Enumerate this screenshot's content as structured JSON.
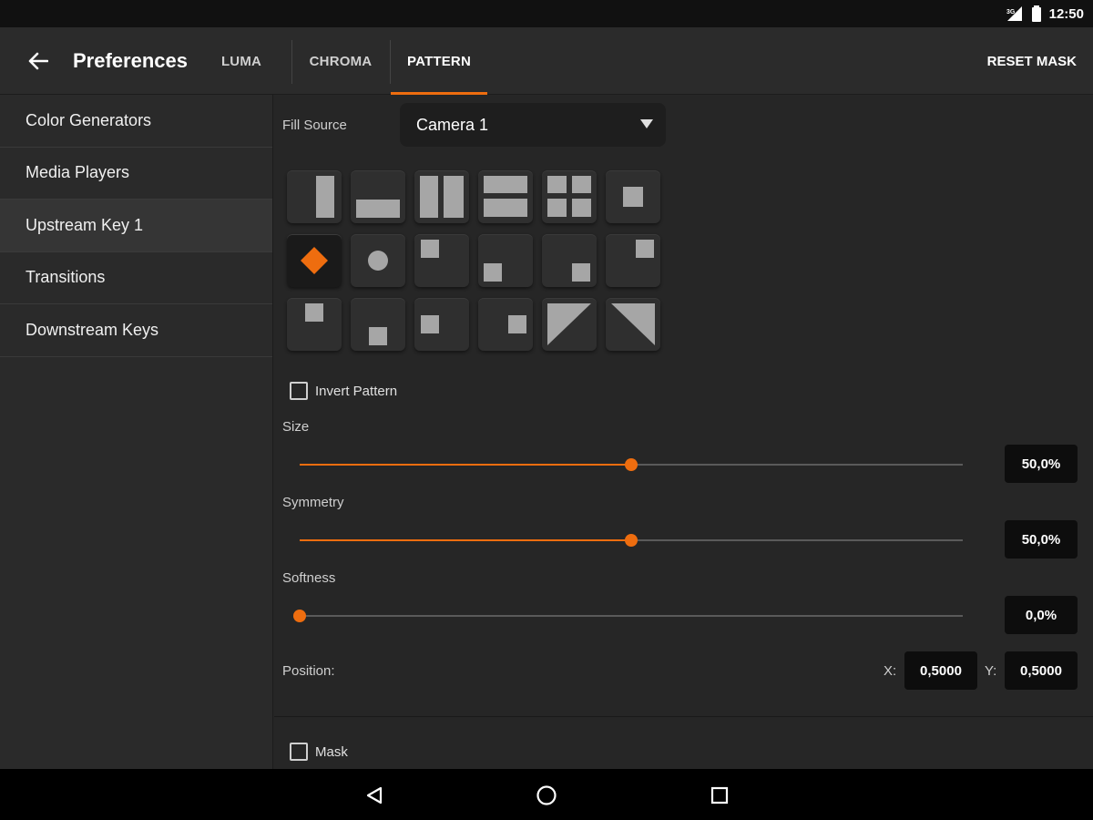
{
  "status_bar": {
    "time": "12:50",
    "icons": [
      "signal-icon",
      "battery-icon"
    ]
  },
  "app_bar": {
    "back_icon": "arrow-back-icon",
    "title": "Preferences",
    "tabs": [
      {
        "label": "LUMA",
        "active": false
      },
      {
        "label": "CHROMA",
        "active": false
      },
      {
        "label": "PATTERN",
        "active": true
      }
    ],
    "reset_label": "RESET MASK"
  },
  "sidebar": {
    "items": [
      {
        "label": "Color Generators",
        "selected": false
      },
      {
        "label": "Media Players",
        "selected": false
      },
      {
        "label": "Upstream Key 1",
        "selected": true
      },
      {
        "label": "Transitions",
        "selected": false
      },
      {
        "label": "Downstream Keys",
        "selected": false
      }
    ]
  },
  "pattern": {
    "fill_source_label": "Fill Source",
    "fill_source_value": "Camera 1",
    "selected_pattern": "diamond-iris",
    "patterns": [
      "left-to-right-bar",
      "top-to-bottom-bar",
      "horizontal-barn-door",
      "vertical-barn-door",
      "corners-in-four-box",
      "rectangle-iris",
      "diamond-iris",
      "circle-iris",
      "top-left-box",
      "top-center-box",
      "top-right-box",
      "middle-right-box",
      "bottom-right-box",
      "bottom-center-box",
      "bottom-left-box",
      "middle-left-box",
      "top-left-diagonal",
      "top-right-diagonal"
    ],
    "invert_label": "Invert Pattern",
    "invert_checked": false,
    "size": {
      "label": "Size",
      "value_text": "50,0%",
      "fraction": 0.5
    },
    "symmetry": {
      "label": "Symmetry",
      "value_text": "50,0%",
      "fraction": 0.5
    },
    "softness": {
      "label": "Softness",
      "value_text": "0,0%",
      "fraction": 0.0
    },
    "position": {
      "label": "Position:",
      "x_label": "X:",
      "x_value": "0,5000",
      "y_label": "Y:",
      "y_value": "0,5000"
    },
    "mask_label": "Mask",
    "mask_checked": false
  },
  "nav_bar": {
    "buttons": [
      "back-triangle-icon",
      "home-circle-icon",
      "recents-square-icon"
    ]
  },
  "colors": {
    "accent": "#ee6d0f",
    "background": "#262626",
    "panel": "#2a2a2a"
  }
}
